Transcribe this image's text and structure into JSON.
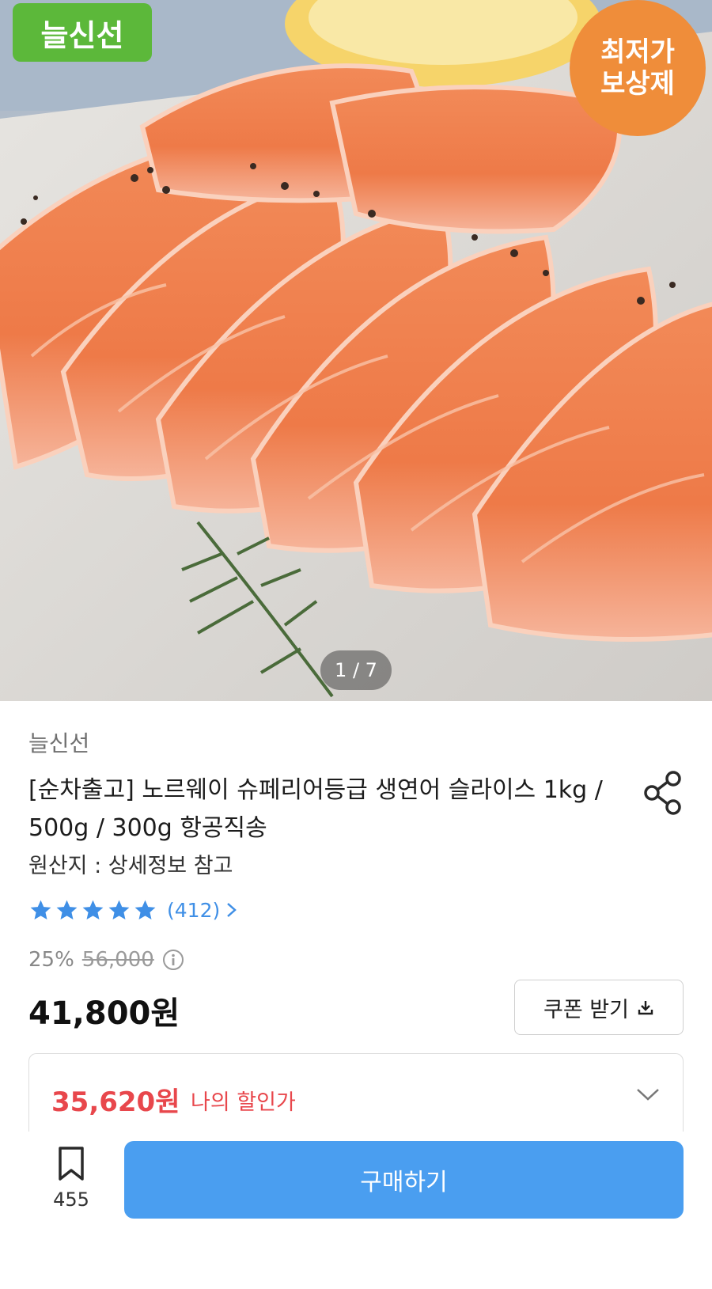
{
  "hero": {
    "brand_tag": "늘신선",
    "badge_line1": "최저가",
    "badge_line2": "보상제",
    "image_index": "1 / 7"
  },
  "product": {
    "seller": "늘신선",
    "title": "[순차출고] 노르웨이 슈페리어등급 생연어 슬라이스 1kg / 500g / 300g 항공직송",
    "origin": "원산지 : 상세정보 참고",
    "rating_stars": 5,
    "review_count": "(412)",
    "discount_rate": "25%",
    "original_price": "56,000",
    "price": "41,800원",
    "coupon_label": "쿠폰 받기",
    "my_discount_amount": "35,620원",
    "my_discount_label": "나의 할인가"
  },
  "bottom": {
    "bookmark_count": "455",
    "buy_label": "구매하기"
  },
  "colors": {
    "accent_blue": "#4a9ef0",
    "discount_red": "#e8474c",
    "brand_green": "#5cb83a",
    "badge_orange": "#ef8d3a",
    "star_blue": "#3f8fe6"
  },
  "icons": [
    "share-icon",
    "star-icon",
    "chevron-right-icon",
    "info-icon",
    "download-icon",
    "chevron-down-icon",
    "bookmark-icon"
  ]
}
